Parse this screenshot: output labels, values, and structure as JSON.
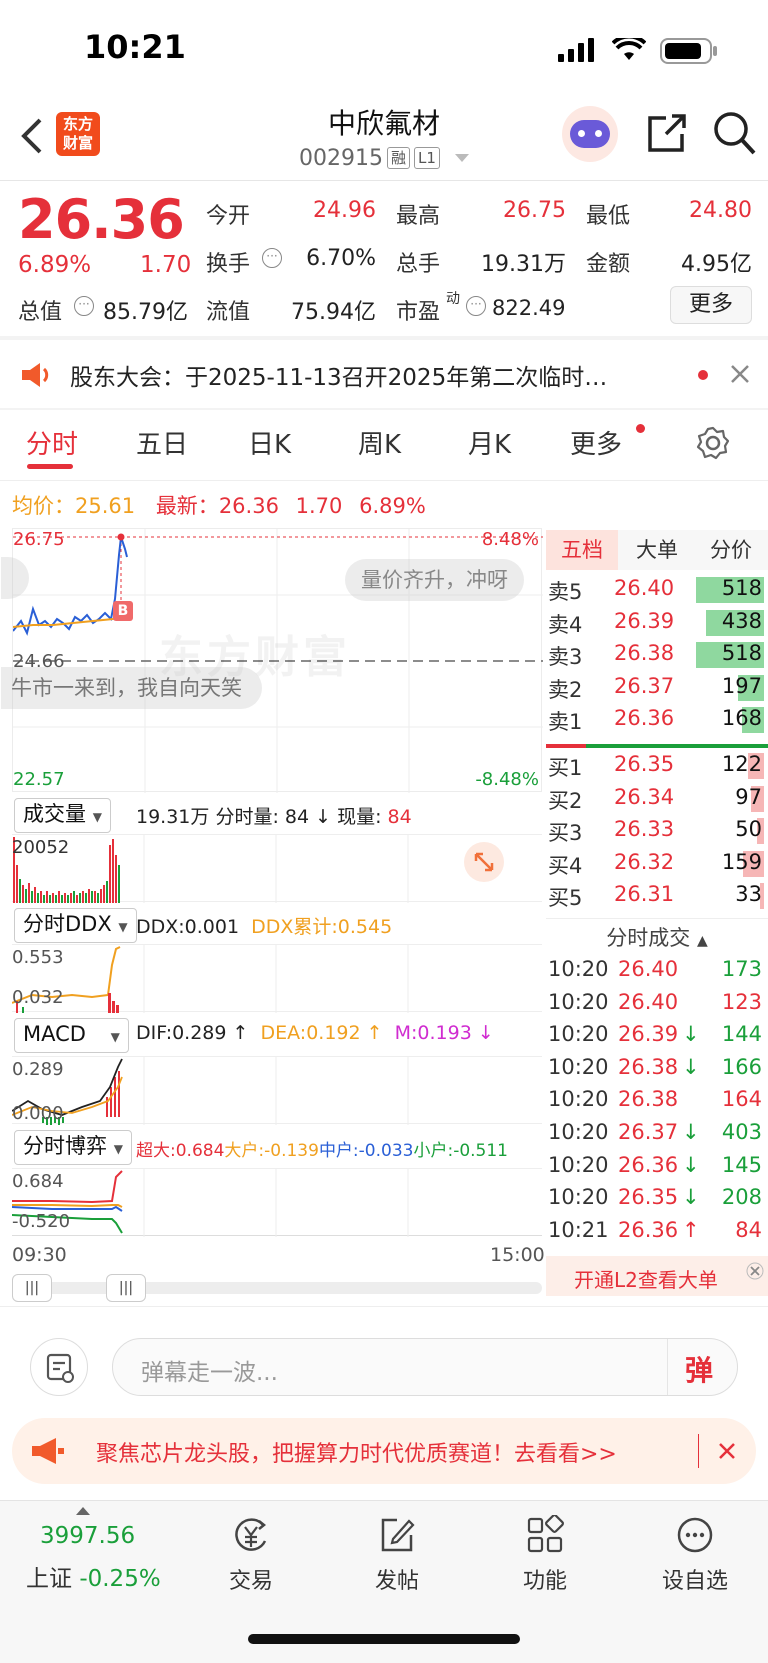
{
  "status": {
    "time": "10:21"
  },
  "header": {
    "logo_text": "东方财富",
    "title": "中欣氟材",
    "code": "002915",
    "tag_margin": "融",
    "tag_level": "L1"
  },
  "quote": {
    "price": "26.36",
    "change_pct": "6.89%",
    "change_amt": "1.70",
    "open_label": "今开",
    "open": "24.96",
    "high_label": "最高",
    "high": "26.75",
    "low_label": "最低",
    "low": "24.80",
    "turnover_label": "换手",
    "turnover": "6.70%",
    "volume_label": "总手",
    "volume": "19.31万",
    "amount_label": "金额",
    "amount": "4.95亿",
    "mktcap_label": "总值",
    "mktcap": "85.79亿",
    "float_label": "流值",
    "float": "75.94亿",
    "pe_label": "市盈",
    "pe_sup": "动",
    "pe": "822.49",
    "more_label": "更多"
  },
  "notice": {
    "text": "股东大会：于2025-11-13召开2025年第二次临时…"
  },
  "tabs": [
    "分时",
    "五日",
    "日K",
    "周K",
    "月K",
    "更多"
  ],
  "intraday": {
    "avg_label": "均价：",
    "avg": "25.61",
    "last_label": "最新：",
    "last": "26.36",
    "chg": "1.70",
    "pct": "6.89%",
    "y_high": "26.75",
    "y_mid": "24.66",
    "y_low": "22.57",
    "pct_high": "8.48%",
    "pct_low": "-8.48%",
    "bubble1": "量价齐升，冲呀",
    "bubble2": "牛市一来到，我自向天笑",
    "marker": "B",
    "watermark": "东方财富",
    "time_start": "09:30",
    "time_end": "15:00"
  },
  "volume_panel": {
    "select": "成交量",
    "total": "19.31万",
    "label2": "分时量: 84",
    "label3": "现量: ",
    "now": "84",
    "ymax": "20052"
  },
  "ddx_panel": {
    "select": "分时DDX",
    "ddx": "DDX:0.001",
    "ddx_cum": "DDX累计:0.545",
    "y1": "0.553",
    "y2": "0.032"
  },
  "macd_panel": {
    "select": "MACD",
    "dif": "DIF:0.289 ↑",
    "dea": "DEA:0.192 ↑",
    "m": "M:0.193 ↓",
    "y1": "0.289",
    "y2": "0.000"
  },
  "game_panel": {
    "select": "分时博弈",
    "super": "超大:0.684",
    "big": "大户:-0.139",
    "mid": "中户:-0.033",
    "small": "小户:-0.511",
    "y1": "0.684",
    "y2": "-0.520"
  },
  "book": {
    "tabs": [
      "五档",
      "大单",
      "分价"
    ],
    "asks": [
      {
        "label": "卖5",
        "price": "26.40",
        "vol": "518",
        "frac": 0.92
      },
      {
        "label": "卖4",
        "price": "26.39",
        "vol": "438",
        "frac": 0.78
      },
      {
        "label": "卖3",
        "price": "26.38",
        "vol": "518",
        "frac": 0.92
      },
      {
        "label": "卖2",
        "price": "26.37",
        "vol": "197",
        "frac": 0.35
      },
      {
        "label": "卖1",
        "price": "26.36",
        "vol": "168",
        "frac": 0.3
      }
    ],
    "bids": [
      {
        "label": "买1",
        "price": "26.35",
        "vol": "122",
        "frac": 0.22
      },
      {
        "label": "买2",
        "price": "26.34",
        "vol": "97",
        "frac": 0.17
      },
      {
        "label": "买3",
        "price": "26.33",
        "vol": "50",
        "frac": 0.09
      },
      {
        "label": "买4",
        "price": "26.32",
        "vol": "159",
        "frac": 0.28
      },
      {
        "label": "买5",
        "price": "26.31",
        "vol": "33",
        "frac": 0.06
      }
    ],
    "trades_title": "分时成交",
    "trades": [
      {
        "time": "10:20",
        "price": "26.40",
        "arrow": "",
        "vol": "173",
        "vol_color": "green"
      },
      {
        "time": "10:20",
        "price": "26.40",
        "arrow": "",
        "vol": "123",
        "vol_color": "red"
      },
      {
        "time": "10:20",
        "price": "26.39",
        "arrow": "↓",
        "vol": "144",
        "vol_color": "green"
      },
      {
        "time": "10:20",
        "price": "26.38",
        "arrow": "↓",
        "vol": "166",
        "vol_color": "green"
      },
      {
        "time": "10:20",
        "price": "26.38",
        "arrow": "",
        "vol": "164",
        "vol_color": "red"
      },
      {
        "time": "10:20",
        "price": "26.37",
        "arrow": "↓",
        "vol": "403",
        "vol_color": "green"
      },
      {
        "time": "10:20",
        "price": "26.36",
        "arrow": "↓",
        "vol": "145",
        "vol_color": "green"
      },
      {
        "time": "10:20",
        "price": "26.35",
        "arrow": "↓",
        "vol": "208",
        "vol_color": "green"
      },
      {
        "time": "10:21",
        "price": "26.36",
        "arrow": "↑",
        "vol": "84",
        "vol_color": "red"
      }
    ],
    "l2_text": "开通L2查看大单"
  },
  "comment": {
    "placeholder": "弹幕走一波...",
    "danmu": "弹"
  },
  "ad": {
    "text": "聚焦芯片龙头股，把握算力时代优质赛道！去看看>>"
  },
  "nav": {
    "index_value": "3997.56",
    "index_name": "上证",
    "index_pct": "-0.25%",
    "items": [
      "交易",
      "发帖",
      "功能",
      "设自选"
    ]
  }
}
